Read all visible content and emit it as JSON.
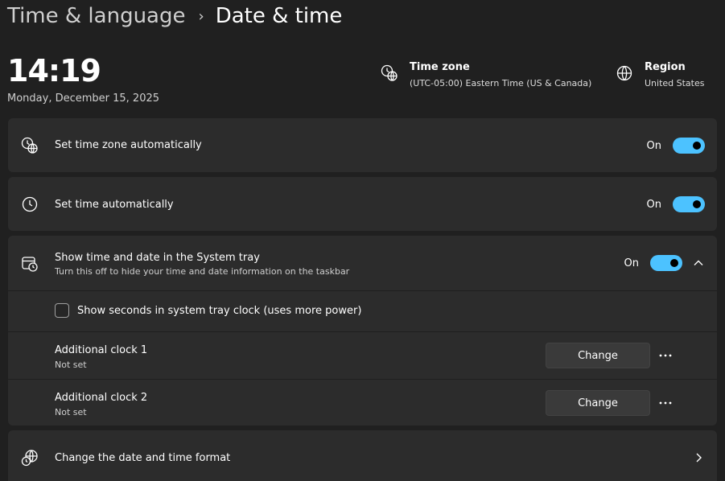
{
  "breadcrumb": {
    "parent": "Time & language",
    "separator": "›",
    "current": "Date & time"
  },
  "current_time": "14:19",
  "current_date": "Monday, December 15, 2025",
  "time_zone": {
    "title": "Time zone",
    "value": "(UTC-05:00) Eastern Time (US & Canada)"
  },
  "region": {
    "title": "Region",
    "value": "United States"
  },
  "settings": {
    "auto_timezone": {
      "label": "Set time zone automatically",
      "state": "On"
    },
    "auto_time": {
      "label": "Set time automatically",
      "state": "On"
    },
    "system_tray": {
      "label": "Show time and date in the System tray",
      "description": "Turn this off to hide your time and date information on the taskbar",
      "state": "On"
    },
    "show_seconds": {
      "label": "Show seconds in system tray clock (uses more power)",
      "checked": false
    },
    "additional_clocks": [
      {
        "label": "Additional clock 1",
        "status": "Not set",
        "button": "Change"
      },
      {
        "label": "Additional clock 2",
        "status": "Not set",
        "button": "Change"
      }
    ],
    "date_format": {
      "label": "Change the date and time format"
    }
  },
  "colors": {
    "accent": "#4cc2ff",
    "background": "#202020",
    "card": "#2c2c2c"
  },
  "icons": [
    "globe-clock-icon",
    "clock-icon",
    "calendar-clock-icon",
    "globe-icon",
    "chevron-up-icon",
    "chevron-right-icon",
    "more-icon"
  ]
}
